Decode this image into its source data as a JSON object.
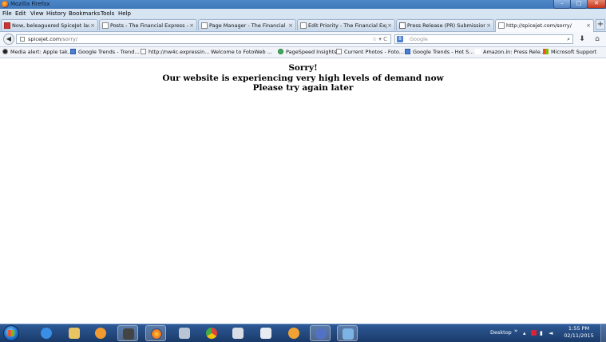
{
  "window": {
    "title": "Mozilla Firefox",
    "min_glyph": "–",
    "max_glyph": "□",
    "close_glyph": "✕"
  },
  "menu": [
    "File",
    "Edit",
    "View",
    "History",
    "Bookmarks",
    "Tools",
    "Help"
  ],
  "tabs": [
    {
      "label": "Now, beleaguered SpiceJet laun...",
      "favicon": "red-square-icon",
      "close": "×"
    },
    {
      "label": "Posts - The Financial Express — ...",
      "favicon": "page-icon",
      "close": "×"
    },
    {
      "label": "Page Manager - The Financial Ex...",
      "favicon": "page-icon",
      "close": "×"
    },
    {
      "label": "Edit Priority - The Financial Expr...",
      "favicon": "page-icon",
      "close": "×"
    },
    {
      "label": "Press Release (PR) Submission S...",
      "favicon": "pr-icon",
      "close": "×"
    },
    {
      "label": "http://spicejet.com/sorry/",
      "favicon": "page-icon",
      "close": "×",
      "active": true
    }
  ],
  "new_tab_glyph": "+",
  "navbar": {
    "url_domain": "spicejet.com",
    "url_path": "/sorry/",
    "url_controls": "☆ ▾ C",
    "search_engine_glyph": "8",
    "search_placeholder": "Google",
    "search_glyph": "⌕",
    "download_glyph": "⬇",
    "home_glyph": "⌂",
    "back_glyph": "◀"
  },
  "bookmarks": [
    {
      "label": "Media alert: Apple tak...",
      "icon": "media-alert-icon"
    },
    {
      "label": "Google Trends - Trend...",
      "icon": "google-icon"
    },
    {
      "label": "http://nw4c.expressin...",
      "icon": "page-icon"
    },
    {
      "label": "Welcome to FotoWeb ...",
      "icon": "page-icon"
    },
    {
      "label": "PageSpeed Insights",
      "icon": "pagespeed-icon"
    },
    {
      "label": "Current Photos - Foto...",
      "icon": "page-icon"
    },
    {
      "label": "Google Trends - Hot S...",
      "icon": "google-icon"
    },
    {
      "label": "Amazon.in: Press Rele...",
      "icon": "amazon-icon"
    },
    {
      "label": "Microsoft Support",
      "icon": "microsoft-icon"
    }
  ],
  "page": {
    "line1": "Sorry!",
    "line2": "Our website is experiencing very high levels of demand now",
    "line3": "Please try again later"
  },
  "taskbar": {
    "desktop_label": "Desktop",
    "chevron": "»",
    "time": "1:55 PM",
    "date": "02/11/2015",
    "apps": [
      {
        "icon": "internet-explorer-icon",
        "color": "#3a8ee6"
      },
      {
        "icon": "folder-icon",
        "color": "#e8c463"
      },
      {
        "icon": "media-player-icon",
        "color": "#f19a32"
      },
      {
        "icon": "camera-icon",
        "color": "#444444"
      },
      {
        "icon": "firefox-icon",
        "color": "#e56b1f"
      },
      {
        "icon": "network-icon",
        "color": "#b9c4d4"
      },
      {
        "icon": "chrome-icon",
        "color": "#3fae49"
      },
      {
        "icon": "paint-icon",
        "color": "#d9dde5"
      },
      {
        "icon": "notepad-icon",
        "color": "#e7ecf3"
      },
      {
        "icon": "flash-icon",
        "color": "#f2a234"
      },
      {
        "icon": "remote-icon",
        "color": "#5271c4"
      },
      {
        "icon": "document-icon",
        "color": "#7db4e6"
      }
    ]
  }
}
